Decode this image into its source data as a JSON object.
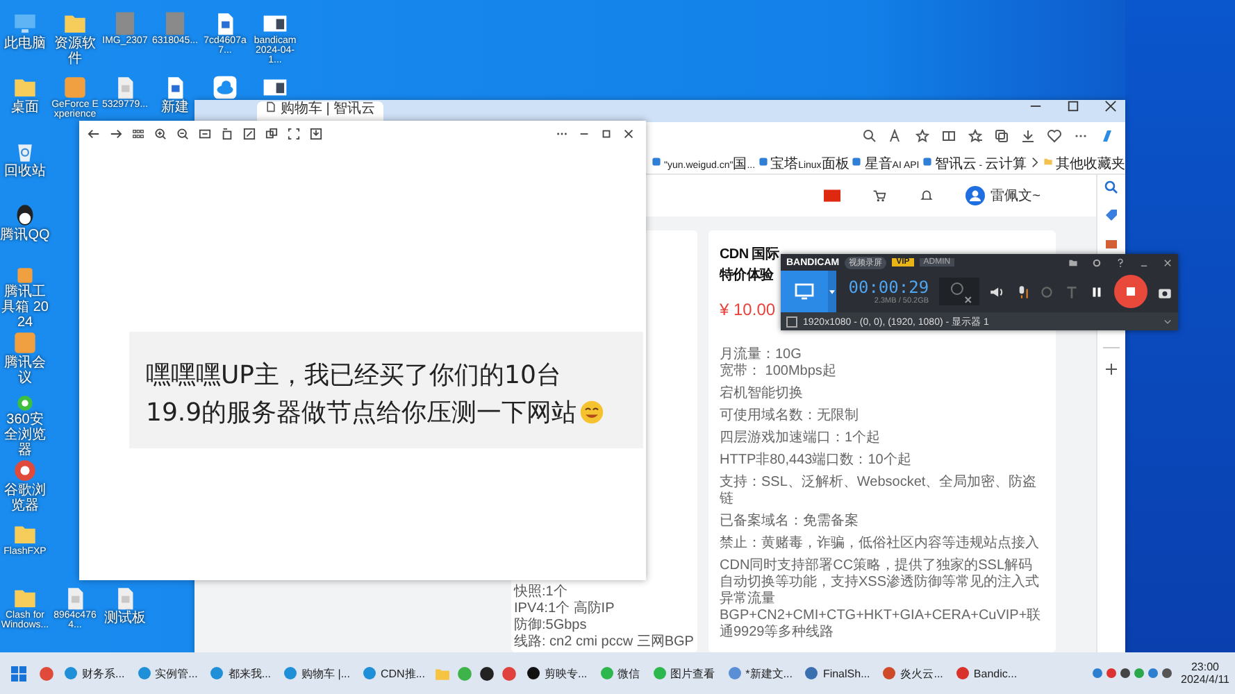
{
  "desktop": {
    "rows": [
      [
        {
          "kind": "pc",
          "label": "此电脑"
        },
        {
          "kind": "folder",
          "label": "资源软件"
        },
        {
          "kind": "photo",
          "label": "IMG_2307"
        },
        {
          "kind": "photo",
          "label": "6318045..."
        },
        {
          "kind": "doc",
          "label": "7cd4607a7..."
        },
        {
          "kind": "screen",
          "label": "bandicam 2024-04-1..."
        }
      ],
      [
        {
          "kind": "folder",
          "label": "桌面"
        },
        {
          "kind": "app",
          "label": "GeForce Experience"
        },
        {
          "kind": "file",
          "label": "5329779..."
        },
        {
          "kind": "doc",
          "label": "新建"
        },
        {
          "kind": "cloud"
        },
        {
          "kind": "screen"
        }
      ],
      [
        {
          "kind": "recycle",
          "label": "回收站"
        }
      ],
      [
        {
          "kind": "qq",
          "label": "腾讯QQ"
        }
      ],
      [
        {
          "kind": "app",
          "label": "腾讯工具箱 2024"
        }
      ],
      [
        {
          "kind": "app",
          "label": "腾讯会议"
        }
      ],
      [
        {
          "kind": "browser",
          "label": "360安全浏览器"
        }
      ],
      [
        {
          "kind": "chrome",
          "label": "谷歌浏览器"
        }
      ],
      [
        {
          "kind": "folder",
          "label": "FlashFXP"
        }
      ],
      [
        {
          "kind": "folder",
          "label": "Clash for Windows..."
        },
        {
          "kind": "file",
          "label": "8964c4764..."
        },
        {
          "kind": "file",
          "label": "测试板"
        }
      ]
    ]
  },
  "browser": {
    "tab": "购物车 | 智讯云",
    "bookmarks": [
      "\"yun.weigud.cn\"国...",
      "宝塔Linux面板",
      "星音AI API",
      "智讯云 - 云计算"
    ],
    "other_bookmarks": "其他收藏夹",
    "user": "雷佩文~",
    "service_lines": [
      "快照:1个",
      "IPV4:1个 高防IP",
      "防御:5Gbps",
      "线路: cn2 cmi pccw 三网BGP"
    ],
    "product": {
      "title": "CDN 国际",
      "subtitle": "特价体验",
      "price": "¥ 10.00",
      "specs": [
        "月流量：10G\n宽带： 100Mbps起",
        "宕机智能切换",
        "可使用域名数：无限制",
        "四层游戏加速端口：1个起",
        "HTTP非80,443端口数：10个起",
        "支持：SSL、泛解析、Websocket、全局加密、防盗链",
        "已备案域名：免需备案",
        "禁止：黄赌毒，诈骗，低俗社区内容等违规站点接入",
        "CDN同时支持部署CC策略，提供了独家的SSL解码自动切换等功能，支持XSS渗透防御等常见的注入式异常流量 BGP+CN2+CMI+CTG+HKT+GIA+CERA+CuVIP+联通9929等多种线路"
      ]
    }
  },
  "viewer": {
    "message": "嘿嘿嘿UP主，我已经买了你们的10台19.9的服务器做节点给你压测一下网站"
  },
  "recorder": {
    "logo": "BANDICAM",
    "mode": "视频录屏",
    "vip": "VIP",
    "user": "ADMIN",
    "timer": "00:00:29",
    "size": "2.3MB / 50.2GB",
    "area": "1920x1080 - (0, 0), (1920, 1080) - 显示器 1",
    "area_checked": false
  },
  "taskbar": {
    "items": [
      {
        "kind": "chrome"
      },
      {
        "kind": "edge",
        "label": "财务系..."
      },
      {
        "kind": "edge",
        "label": "实例管..."
      },
      {
        "kind": "edge",
        "label": "都来我..."
      },
      {
        "kind": "edge",
        "label": "购物车 |..."
      },
      {
        "kind": "edge",
        "label": "CDN推..."
      },
      {
        "kind": "folder"
      },
      {
        "kind": "security"
      },
      {
        "kind": "qq"
      },
      {
        "kind": "music"
      },
      {
        "kind": "editor",
        "label": "剪映专..."
      },
      {
        "kind": "wechat",
        "label": "微信"
      },
      {
        "kind": "wechat",
        "label": "图片查看"
      },
      {
        "kind": "notepad",
        "label": "*新建文..."
      },
      {
        "kind": "terminal",
        "label": "FinalSh..."
      },
      {
        "kind": "web",
        "label": "炎火云..."
      },
      {
        "kind": "recorder",
        "label": "Bandic..."
      }
    ],
    "time": "23:00",
    "date": "2024/4/11"
  }
}
